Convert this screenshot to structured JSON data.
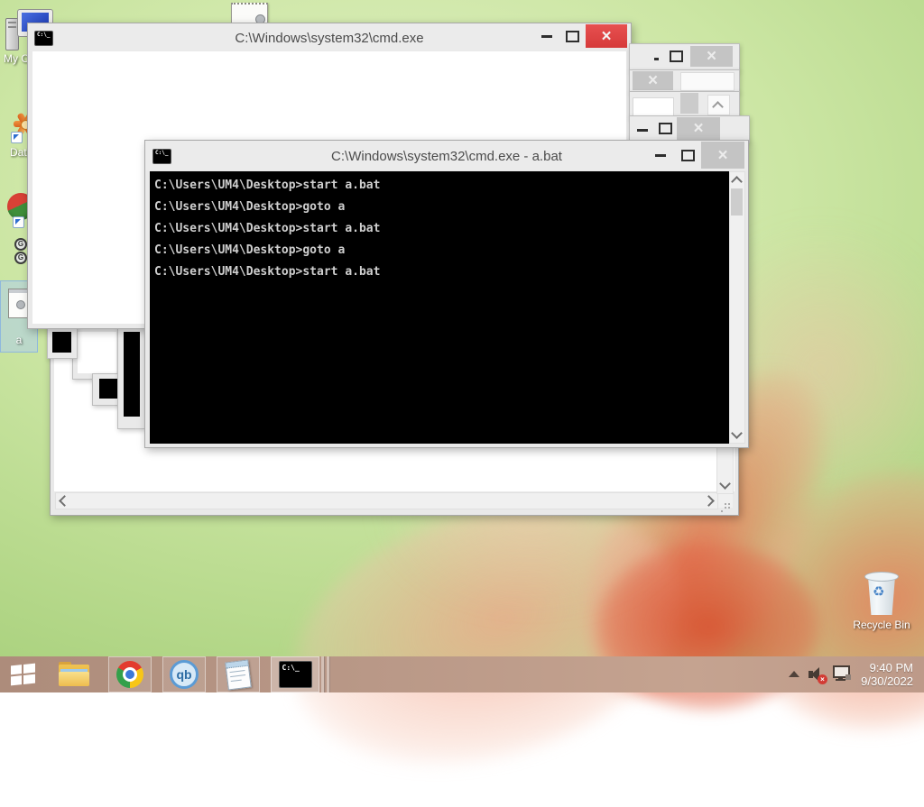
{
  "desktop": {
    "icons": {
      "my_computer": {
        "label": "My C"
      },
      "data_shortcut": {
        "label": "Data"
      },
      "a_bat": {
        "label": "a"
      },
      "recycle_bin": {
        "label": "Recycle Bin"
      }
    }
  },
  "windows": {
    "back_cmd": {
      "title": "C:\\Windows\\system32\\cmd.exe"
    },
    "front_cmd": {
      "title": "C:\\Windows\\system32\\cmd.exe - a.bat",
      "lines": [
        "C:\\Users\\UM4\\Desktop>start a.bat",
        "C:\\Users\\UM4\\Desktop>goto a",
        "C:\\Users\\UM4\\Desktop>start a.bat",
        "C:\\Users\\UM4\\Desktop>goto a",
        "C:\\Users\\UM4\\Desktop>start a.bat"
      ]
    }
  },
  "taskbar": {
    "qb_label": "qb",
    "cmd_icon_text": "C:\\_",
    "tray": {
      "time": "9:40 PM",
      "date": "9/30/2022"
    }
  },
  "colors": {
    "desktop_green": "#bcdc92",
    "flower_pink": "#e8795a",
    "flower_deep": "#d8502f",
    "taskbar_brown": "#b79686",
    "close_red": "#e14444",
    "selection_blue": "#aecde8"
  }
}
